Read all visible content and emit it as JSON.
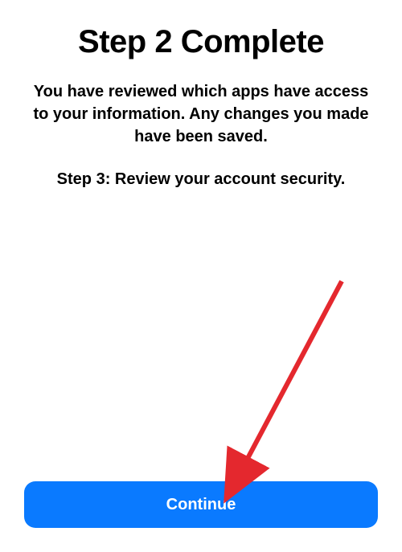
{
  "title": "Step 2 Complete",
  "description": "You have reviewed which apps have access to your information. Any changes you made have been saved.",
  "next_step": "Step 3: Review your account security.",
  "continue_label": "Continue",
  "colors": {
    "button_bg": "#0a7aff",
    "arrow": "#e4282e"
  }
}
